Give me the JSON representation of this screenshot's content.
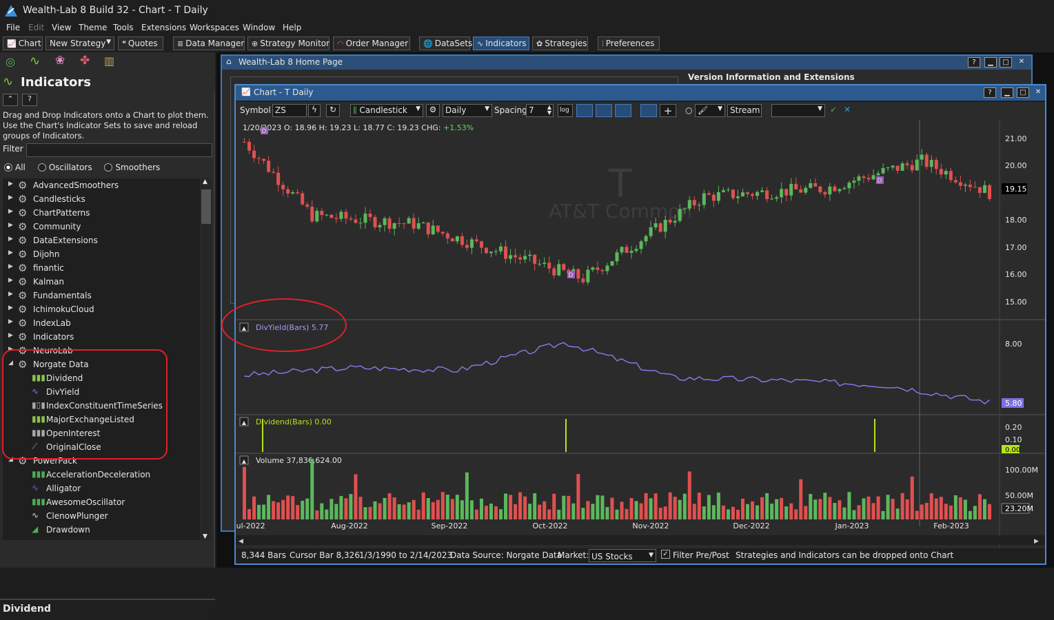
{
  "app": {
    "title": "Wealth-Lab 8 Build 32 - Chart - T Daily"
  },
  "menu": [
    "File",
    "Edit",
    "View",
    "Theme",
    "Tools",
    "Extensions",
    "Workspaces",
    "Window",
    "Help"
  ],
  "toolbar": {
    "chart": "Chart",
    "new_strategy": "New Strategy",
    "quotes": "Quotes",
    "data_manager": "Data Manager",
    "strategy_monitor": "Strategy Monitor",
    "order_manager": "Order Manager",
    "datasets": "DataSets",
    "indicators": "Indicators",
    "strategies": "Strategies",
    "preferences": "Preferences"
  },
  "left": {
    "title": "Indicators",
    "description": "Drag and Drop Indicators onto a Chart to plot them. Use the Chart's Indicator Sets to save and reload groups of Indicators.",
    "filter_label": "Filter",
    "radios": [
      "All",
      "Oscillators",
      "Smoothers"
    ],
    "tree": [
      "AdvancedSmoothers",
      "Candlesticks",
      "ChartPatterns",
      "Community",
      "DataExtensions",
      "Dijohn",
      "finantic",
      "Kalman",
      "Fundamentals",
      "IchimokuCloud",
      "IndexLab",
      "Indicators",
      "NeuroLab",
      "Norgate Data"
    ],
    "norgate_children": [
      "Dividend",
      "DivYield",
      "IndexConstituentTimeSeries",
      "MajorExchangeListed",
      "OpenInterest",
      "OriginalClose"
    ],
    "powerpack": "PowerPack",
    "powerpack_children": [
      "AccelerationDeceleration",
      "Alligator",
      "AwesomeOscillator",
      "ClenowPlunger",
      "Drawdown"
    ],
    "bottom_title": "Dividend"
  },
  "home": {
    "title": "Wealth-Lab 8 Home Page",
    "version_header": "Version Information and Extensions"
  },
  "chart": {
    "title": "Chart - T Daily",
    "symbol_label": "Symbol",
    "symbol": "ZS",
    "style": "Candlestick",
    "scale": "Daily",
    "spacing_label": "Spacing",
    "spacing": "7",
    "log": "log",
    "stream": "Stream",
    "ohlc": {
      "date": "1/20/2023",
      "o_lbl": "O:",
      "o": "18.96",
      "h_lbl": "H:",
      "h": "19.23",
      "l_lbl": "L:",
      "l": "18.77",
      "c_lbl": "C:",
      "c": "19.23",
      "chg_lbl": "CHG:",
      "chg": "+1.53%"
    },
    "watermark_symbol": "T",
    "watermark_name": "AT&T Common",
    "price_axis": [
      "21.00",
      "20.00",
      "18.00",
      "17.00",
      "16.00",
      "15.00"
    ],
    "last_price": "19.15",
    "divyield_label": "DivYield(Bars) 5.77",
    "divyield_axis": "8.00",
    "divyield_last": "5.80",
    "dividend_label": "Dividend(Bars) 0.00",
    "dividend_axis": [
      "0.20",
      "0.10"
    ],
    "dividend_last": "0.00",
    "volume_label": "Volume 37,836,624.00",
    "volume_axis": [
      "100.00M",
      "50.00M"
    ],
    "volume_last": "23.20M",
    "date_axis": [
      "Jul-2022",
      "Aug-2022",
      "Sep-2022",
      "Oct-2022",
      "Nov-2022",
      "Dec-2022",
      "Jan-2023",
      "Feb-2023"
    ],
    "div_marker": "D"
  },
  "status": {
    "bars": "8,344 Bars",
    "cursor": "Cursor Bar 8,326",
    "range": "1/3/1990 to 2/14/2023",
    "source": "Data Source: Norgate Data",
    "market_label": "Market:",
    "market": "US Stocks",
    "filter": "Filter Pre/Post",
    "hint": "Strategies and Indicators can be dropped onto Chart"
  },
  "chart_data": {
    "type": "line",
    "series": [
      {
        "name": "DivYield(Bars)",
        "x": [
          "Jul-2022",
          "Aug-2022",
          "Sep-2022",
          "Oct-2022",
          "Nov-2022",
          "Dec-2022",
          "Jan-2023",
          "Feb-2023"
        ],
        "values": [
          6.9,
          7.2,
          7.1,
          8.2,
          6.8,
          6.7,
          6.5,
          5.8
        ]
      }
    ],
    "price_close": [
      21.0,
      18.3,
      18.0,
      16.0,
      17.2,
      19.0,
      19.3,
      20.3,
      19.15
    ],
    "ylim_price": [
      14.5,
      21.4
    ]
  }
}
